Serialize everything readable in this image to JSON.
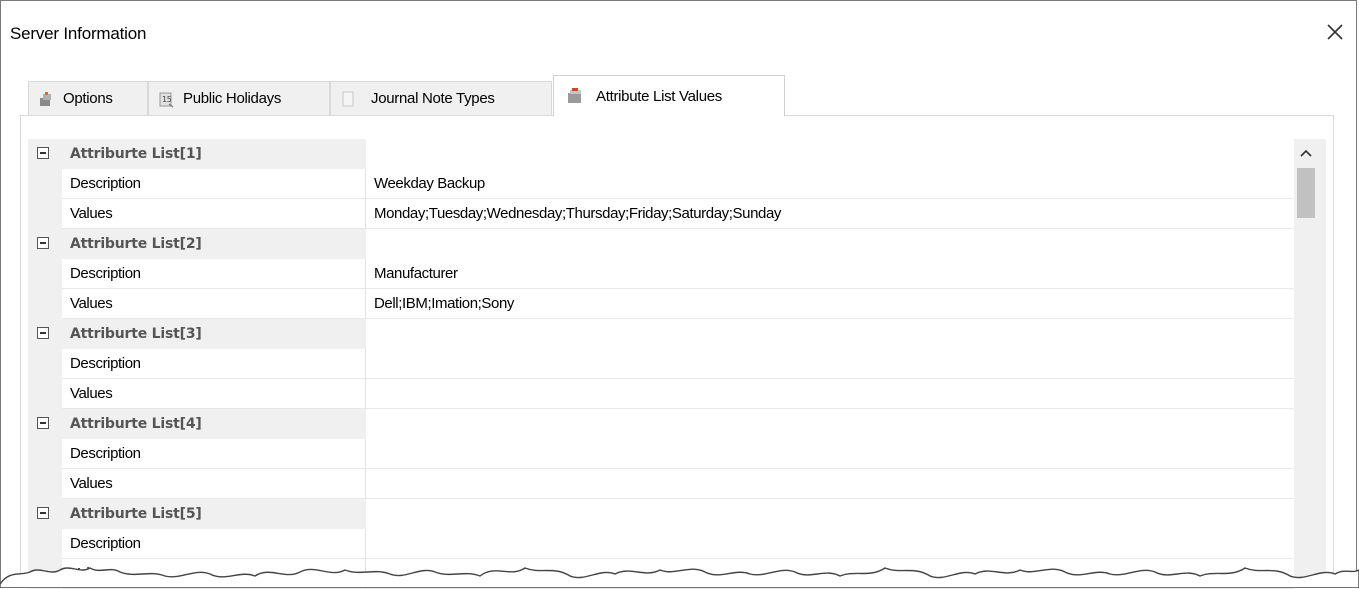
{
  "window": {
    "title": "Server Information"
  },
  "tabs": [
    {
      "label": "Options",
      "icon": "options-icon"
    },
    {
      "label": "Public Holidays",
      "icon": "calendar-icon"
    },
    {
      "label": "Journal Note Types",
      "icon": "note-icon"
    },
    {
      "label": "Attribute List Values",
      "icon": "attribute-list-icon",
      "active": true
    }
  ],
  "grid": {
    "rows": [
      {
        "kind": "category",
        "name": "Attriburte List[1]",
        "value": ""
      },
      {
        "kind": "property",
        "name": "Description",
        "value": "Weekday Backup"
      },
      {
        "kind": "property",
        "name": "Values",
        "value": "Monday;Tuesday;Wednesday;Thursday;Friday;Saturday;Sunday"
      },
      {
        "kind": "category",
        "name": "Attriburte List[2]",
        "value": ""
      },
      {
        "kind": "property",
        "name": "Description",
        "value": "Manufacturer"
      },
      {
        "kind": "property",
        "name": "Values",
        "value": "Dell;IBM;Imation;Sony"
      },
      {
        "kind": "category",
        "name": "Attriburte List[3]",
        "value": ""
      },
      {
        "kind": "property",
        "name": "Description",
        "value": ""
      },
      {
        "kind": "property",
        "name": "Values",
        "value": ""
      },
      {
        "kind": "category",
        "name": "Attriburte List[4]",
        "value": ""
      },
      {
        "kind": "property",
        "name": "Description",
        "value": ""
      },
      {
        "kind": "property",
        "name": "Values",
        "value": ""
      },
      {
        "kind": "category",
        "name": "Attriburte List[5]",
        "value": ""
      },
      {
        "kind": "property",
        "name": "Description",
        "value": ""
      },
      {
        "kind": "property",
        "name": "Values",
        "value": ""
      }
    ]
  },
  "scrollbar": {
    "position": 0
  },
  "colors": {
    "category_bg": "#f0f0f0",
    "category_text": "#555555",
    "tab_active_bg": "#ffffff",
    "tab_bg": "#f0f0f0"
  }
}
